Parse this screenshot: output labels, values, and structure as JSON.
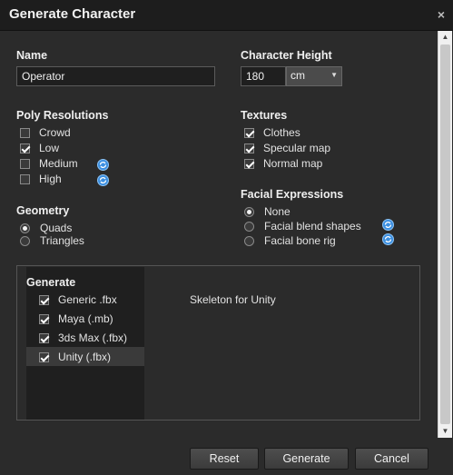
{
  "window": {
    "title": "Generate Character",
    "close_glyph": "×"
  },
  "name": {
    "label": "Name",
    "value": "Operator"
  },
  "height": {
    "label": "Character Height",
    "value": "180",
    "unit": "cm"
  },
  "poly": {
    "label": "Poly Resolutions",
    "items": [
      {
        "label": "Crowd",
        "checked": false
      },
      {
        "label": "Low",
        "checked": true
      },
      {
        "label": "Medium",
        "checked": false,
        "icon": "sync-icon"
      },
      {
        "label": "High",
        "checked": false,
        "icon": "sync-icon"
      }
    ]
  },
  "textures": {
    "label": "Textures",
    "items": [
      {
        "label": "Clothes",
        "checked": true
      },
      {
        "label": "Specular map",
        "checked": true
      },
      {
        "label": "Normal map",
        "checked": true
      }
    ]
  },
  "geometry": {
    "label": "Geometry",
    "items": [
      {
        "label": "Quads",
        "selected": true
      },
      {
        "label": "Triangles",
        "selected": false
      }
    ]
  },
  "facial": {
    "label": "Facial Expressions",
    "items": [
      {
        "label": "None",
        "selected": true
      },
      {
        "label": "Facial blend shapes",
        "selected": false,
        "icon": "sync-icon"
      },
      {
        "label": "Facial bone rig",
        "selected": false,
        "icon": "sync-icon"
      }
    ]
  },
  "generate_panel": {
    "label": "Generate",
    "items": [
      {
        "label": "Generic .fbx",
        "checked": true
      },
      {
        "label": "Maya (.mb)",
        "checked": true
      },
      {
        "label": "3ds Max (.fbx)",
        "checked": true
      },
      {
        "label": "Unity (.fbx)",
        "checked": true,
        "selected": true
      }
    ],
    "detail": "Skeleton for Unity"
  },
  "buttons": {
    "reset": "Reset",
    "generate": "Generate",
    "cancel": "Cancel"
  },
  "colors": {
    "accent": "#3c8fe0",
    "background": "#2b2b2b",
    "titlebar": "#1d1d1d"
  }
}
